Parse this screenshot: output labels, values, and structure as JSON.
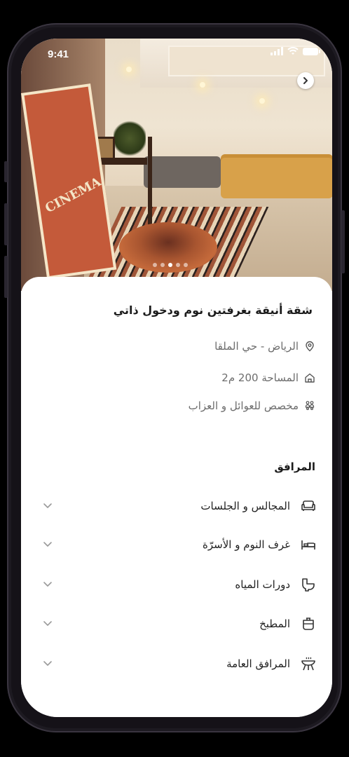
{
  "status_bar": {
    "time": "9:41"
  },
  "gallery": {
    "page_count": 5,
    "active_index": 2
  },
  "listing": {
    "title": "شقة أنيقة بغرفتين نوم ودخول ذاتي",
    "location": "الرياض - حي الملقا",
    "area": "المساحة 200 م2",
    "audience": "مخصص للعوائل و العزاب"
  },
  "amenities": {
    "section_title": "المرافق",
    "items": [
      {
        "label": "المجالس و الجلسات",
        "icon": "sofa-icon"
      },
      {
        "label": "غرف النوم و الأسرّة",
        "icon": "bed-icon"
      },
      {
        "label": "دورات المياه",
        "icon": "toilet-icon"
      },
      {
        "label": "المطبخ",
        "icon": "kitchen-pot-icon"
      },
      {
        "label": "المرافق العامة",
        "icon": "grill-icon"
      }
    ]
  },
  "colors": {
    "accent": "#1b1b1b",
    "muted": "#6d6d6d",
    "icon": "#333333"
  }
}
